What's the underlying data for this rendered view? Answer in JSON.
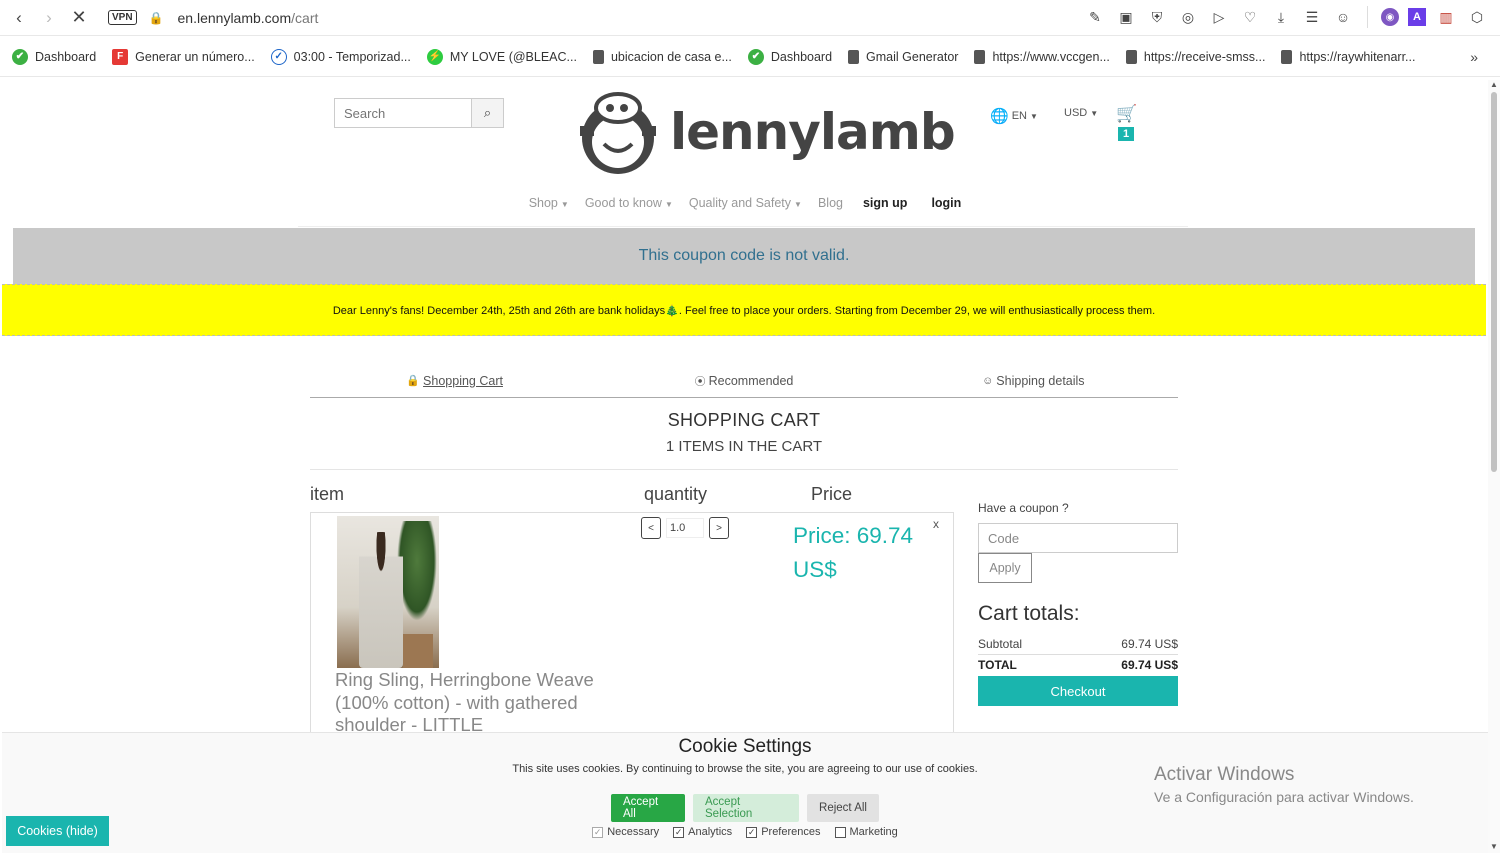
{
  "browser": {
    "url_host": "en.lennylamb.com",
    "url_path": "/cart",
    "vpn_label": "VPN"
  },
  "bookmarks": [
    {
      "label": "Dashboard",
      "color": "#3cb043"
    },
    {
      "label": "Generar un número...",
      "color": "#e53935"
    },
    {
      "label": "03:00 - Temporizad...",
      "color": "#1e66c9"
    },
    {
      "label": "MY LOVE (@BLEAC...",
      "color": "#2ecc40"
    },
    {
      "label": "ubicacion de casa e...",
      "color": "#555555"
    },
    {
      "label": "Dashboard",
      "color": "#3cb043"
    },
    {
      "label": "Gmail Generator",
      "color": "#555555"
    },
    {
      "label": "https://www.vccgen...",
      "color": "#555555"
    },
    {
      "label": "https://receive-smss...",
      "color": "#555555"
    },
    {
      "label": "https://raywhitenarr...",
      "color": "#555555"
    }
  ],
  "header": {
    "search_placeholder": "Search",
    "logo_text": "lennylamb",
    "language": "EN",
    "currency": "USD",
    "cart_count": "1"
  },
  "nav": {
    "shop": "Shop",
    "good_to_know": "Good to know",
    "quality": "Quality and Safety",
    "blog": "Blog",
    "signup": "sign up",
    "login": "login"
  },
  "alerts": {
    "coupon_error": "This coupon code is not valid.",
    "holiday_notice": "Dear Lenny's fans! December 24th, 25th and 26th are bank holidays🎄. Feel free to place your orders. Starting from December 29, we will enthusiastically process them."
  },
  "steps": {
    "cart": "Shopping Cart",
    "recommended": "Recommended",
    "shipping": "Shipping details"
  },
  "cart": {
    "title": "SHOPPING CART",
    "subtitle": "1 ITEMS IN THE CART",
    "col_item": "item",
    "col_quantity": "quantity",
    "col_price": "Price",
    "item": {
      "name": "Ring Sling, Herringbone Weave (100% cotton) - with gathered shoulder - LITTLE",
      "quantity": "1.0",
      "price": "Price: 69.74 US$",
      "remove": "x",
      "qty_minus": "<",
      "qty_plus": ">"
    }
  },
  "coupon": {
    "label": "Have a coupon ?",
    "placeholder": "Code",
    "apply": "Apply"
  },
  "totals": {
    "title": "Cart totals:",
    "subtotal_label": "Subtotal",
    "subtotal_value": "69.74 US$",
    "total_label": "TOTAL",
    "total_value": "69.74 US$",
    "checkout": "Checkout"
  },
  "cookies": {
    "title": "Cookie Settings",
    "text": "This site uses cookies. By continuing to browse the site, you are agreeing to our use of cookies.",
    "accept_all": "Accept All",
    "accept_selection": "Accept Selection",
    "reject_all": "Reject All",
    "necessary": "Necessary",
    "analytics": "Analytics",
    "preferences": "Preferences",
    "marketing": "Marketing",
    "hide_button": "Cookies (hide)"
  },
  "watermark": {
    "line1": "Activar Windows",
    "line2": "Ve a Configuración para activar Windows."
  },
  "colors": {
    "accent": "#1ab5ae",
    "alert_bg": "#c8c8c8",
    "notice_bg": "#ffff00",
    "accept_green": "#28a745"
  }
}
